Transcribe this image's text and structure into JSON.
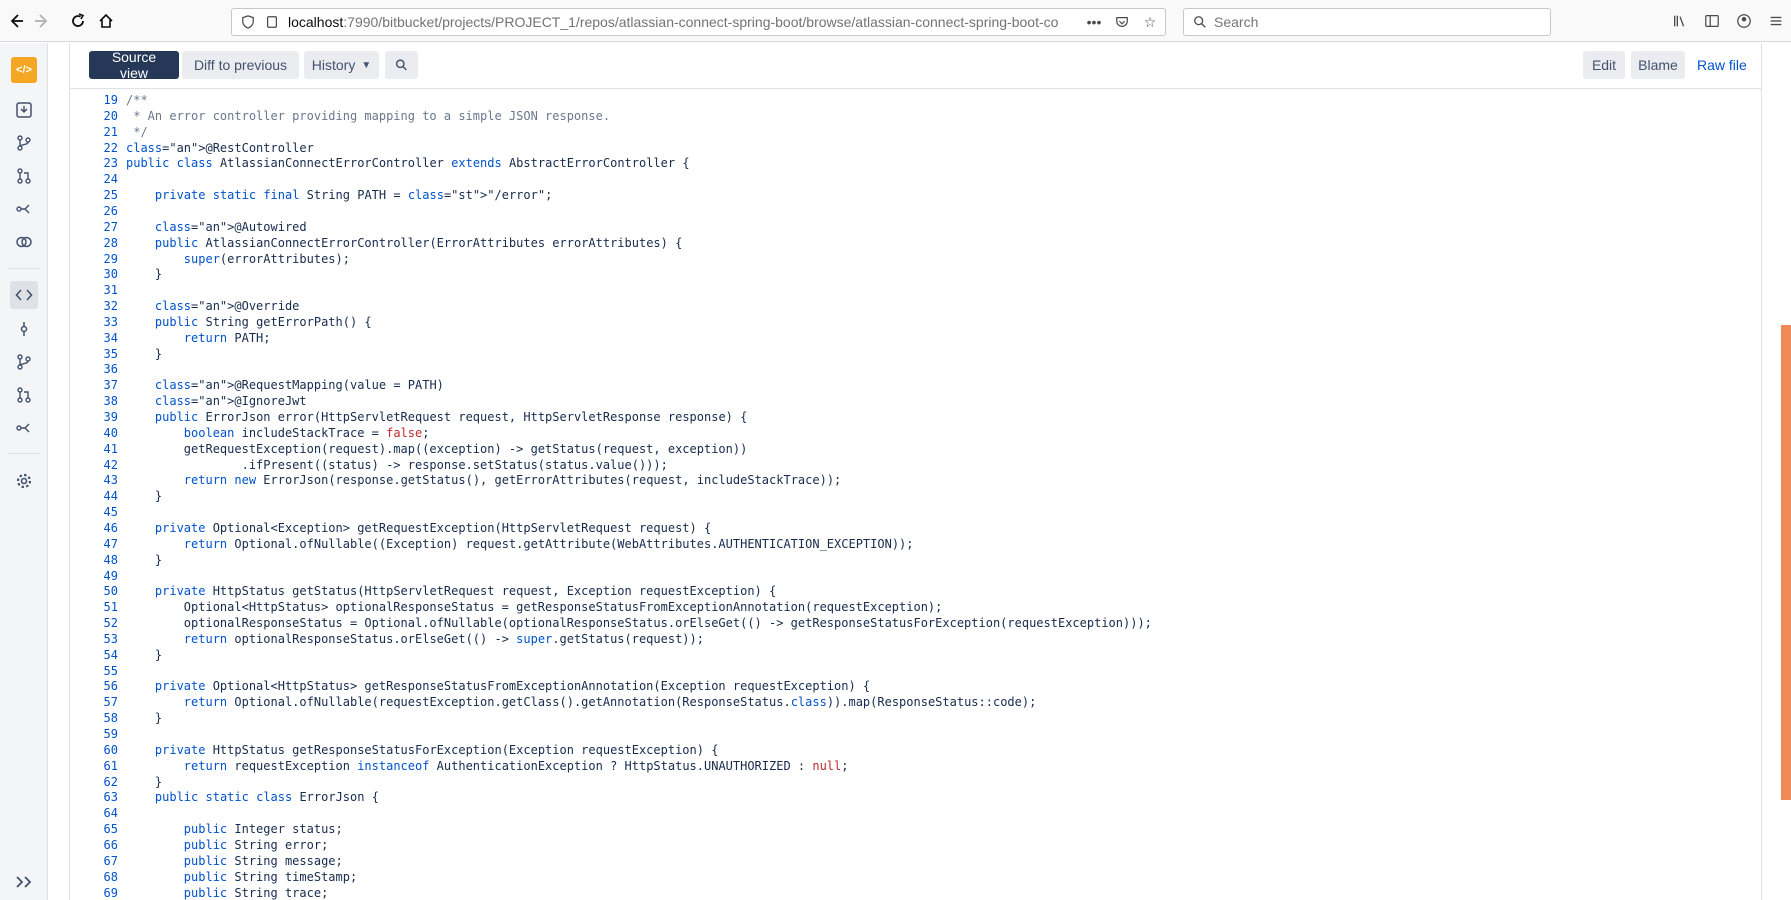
{
  "browser": {
    "url_host": "localhost",
    "url_rest": ":7990/bitbucket/projects/PROJECT_1/repos/atlassian-connect-spring-boot/browse/atlassian-connect-spring-boot-co",
    "search_placeholder": "Search"
  },
  "toolbar": {
    "source_view": "Source view",
    "diff_to_previous": "Diff to previous",
    "history": "History",
    "edit": "Edit",
    "blame": "Blame",
    "raw_file": "Raw file"
  },
  "code_lines": [
    {
      "n": "19",
      "t": "/**"
    },
    {
      "n": "20",
      "t": " * An error controller providing mapping to a simple JSON response."
    },
    {
      "n": "21",
      "t": " */"
    },
    {
      "n": "22",
      "t": "@RestController"
    },
    {
      "n": "23",
      "t": "public class AtlassianConnectErrorController extends AbstractErrorController {"
    },
    {
      "n": "24",
      "t": ""
    },
    {
      "n": "25",
      "t": "    private static final String PATH = \"/error\";"
    },
    {
      "n": "26",
      "t": ""
    },
    {
      "n": "27",
      "t": "    @Autowired"
    },
    {
      "n": "28",
      "t": "    public AtlassianConnectErrorController(ErrorAttributes errorAttributes) {"
    },
    {
      "n": "29",
      "t": "        super(errorAttributes);"
    },
    {
      "n": "30",
      "t": "    }"
    },
    {
      "n": "31",
      "t": ""
    },
    {
      "n": "32",
      "t": "    @Override"
    },
    {
      "n": "33",
      "t": "    public String getErrorPath() {"
    },
    {
      "n": "34",
      "t": "        return PATH;"
    },
    {
      "n": "35",
      "t": "    }"
    },
    {
      "n": "36",
      "t": ""
    },
    {
      "n": "37",
      "t": "    @RequestMapping(value = PATH)"
    },
    {
      "n": "38",
      "t": "    @IgnoreJwt"
    },
    {
      "n": "39",
      "t": "    public ErrorJson error(HttpServletRequest request, HttpServletResponse response) {"
    },
    {
      "n": "40",
      "t": "        boolean includeStackTrace = false;"
    },
    {
      "n": "41",
      "t": "        getRequestException(request).map((exception) -> getStatus(request, exception))"
    },
    {
      "n": "42",
      "t": "                .ifPresent((status) -> response.setStatus(status.value()));"
    },
    {
      "n": "43",
      "t": "        return new ErrorJson(response.getStatus(), getErrorAttributes(request, includeStackTrace));"
    },
    {
      "n": "44",
      "t": "    }"
    },
    {
      "n": "45",
      "t": ""
    },
    {
      "n": "46",
      "t": "    private Optional<Exception> getRequestException(HttpServletRequest request) {"
    },
    {
      "n": "47",
      "t": "        return Optional.ofNullable((Exception) request.getAttribute(WebAttributes.AUTHENTICATION_EXCEPTION));"
    },
    {
      "n": "48",
      "t": "    }"
    },
    {
      "n": "49",
      "t": ""
    },
    {
      "n": "50",
      "t": "    private HttpStatus getStatus(HttpServletRequest request, Exception requestException) {"
    },
    {
      "n": "51",
      "t": "        Optional<HttpStatus> optionalResponseStatus = getResponseStatusFromExceptionAnnotation(requestException);"
    },
    {
      "n": "52",
      "t": "        optionalResponseStatus = Optional.ofNullable(optionalResponseStatus.orElseGet(() -> getResponseStatusForException(requestException)));"
    },
    {
      "n": "53",
      "t": "        return optionalResponseStatus.orElseGet(() -> super.getStatus(request));"
    },
    {
      "n": "54",
      "t": "    }"
    },
    {
      "n": "55",
      "t": ""
    },
    {
      "n": "56",
      "t": "    private Optional<HttpStatus> getResponseStatusFromExceptionAnnotation(Exception requestException) {"
    },
    {
      "n": "57",
      "t": "        return Optional.ofNullable(requestException.getClass().getAnnotation(ResponseStatus.class)).map(ResponseStatus::code);"
    },
    {
      "n": "58",
      "t": "    }"
    },
    {
      "n": "59",
      "t": ""
    },
    {
      "n": "60",
      "t": "    private HttpStatus getResponseStatusForException(Exception requestException) {"
    },
    {
      "n": "61",
      "t": "        return requestException instanceof AuthenticationException ? HttpStatus.UNAUTHORIZED : null;"
    },
    {
      "n": "62",
      "t": "    }"
    },
    {
      "n": "63",
      "t": "    public static class ErrorJson {"
    },
    {
      "n": "64",
      "t": ""
    },
    {
      "n": "65",
      "t": "        public Integer status;"
    },
    {
      "n": "66",
      "t": "        public String error;"
    },
    {
      "n": "67",
      "t": "        public String message;"
    },
    {
      "n": "68",
      "t": "        public String timeStamp;"
    },
    {
      "n": "69",
      "t": "        public String trace;"
    }
  ],
  "colors": {
    "accent": "#0052cc",
    "selected_button": "#253858",
    "annotation": "#c1272d",
    "scrollbar": "#ee8a5a",
    "logo": "#f5a623"
  },
  "icons": [
    "back-icon",
    "forward-icon",
    "reload-icon",
    "home-icon",
    "shield-icon",
    "info-icon",
    "more-icon",
    "pocket-icon",
    "star-icon",
    "search-icon",
    "library-icon",
    "sidebar-icon",
    "account-icon",
    "menu-icon",
    "repo-logo-icon",
    "clone-icon",
    "branch-icon",
    "pull-request-icon",
    "fork-icon",
    "compare-icon",
    "source-icon",
    "commits-icon",
    "branches-icon",
    "pull-requests-icon",
    "forks-icon",
    "settings-icon",
    "expand-icon"
  ]
}
